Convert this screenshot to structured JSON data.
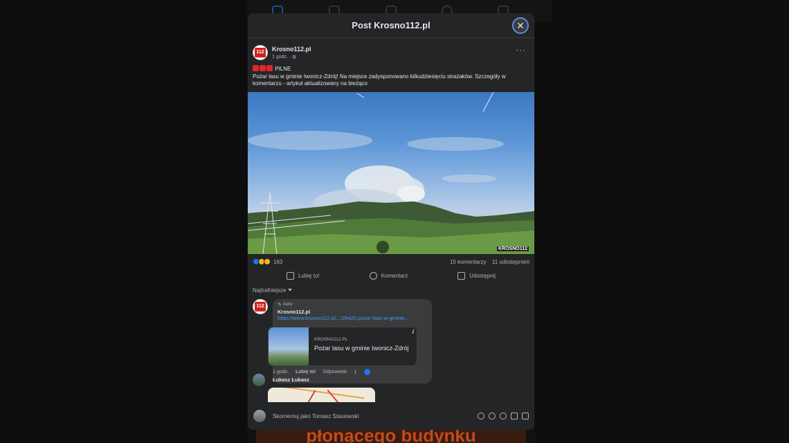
{
  "background": {
    "banner_text": "płonącego budynku"
  },
  "modal": {
    "title": "Post Krosno112.pl",
    "close_label": "✕"
  },
  "post": {
    "avatar_text": "112",
    "author": "Krosno112.pl",
    "time": "1 godz. · ",
    "globe_icon": "globe-icon",
    "more_label": "···",
    "tag": "PILNE",
    "text": "Pożar lasu w gminie Iwonicz-Zdrój! Na miejsce zadysponowano kilkudziesięciu strażaków. Szczegóły w komentarzu - artykuł aktualizowany na bieżąco",
    "photo_watermark": "KROSNO112"
  },
  "reactions": {
    "count": "163",
    "comments": "15 komentarzy",
    "shares": "11 udostępnień"
  },
  "actions": {
    "like": "Lubię to!",
    "comment": "Komentarz",
    "share": "Udostępnij"
  },
  "sort": {
    "label": "Najtrafniejsze"
  },
  "comment1": {
    "author_tag": "Autor",
    "name": "Krosno112.pl",
    "link": "https://www.krosno112.pl/.../29420,pozar-lasu-w-gminie...",
    "card_domain": "KROSNO112.PL",
    "card_title": "Pożar lasu w gminie Iwonicz-Zdrój",
    "card_info": "i",
    "time": "1 godz.",
    "like": "Lubię to!",
    "reply": "Odpowiedz",
    "likes": "1"
  },
  "comment2": {
    "name": "Łukasz Łukasz"
  },
  "composer": {
    "placeholder": "Skomentuj jako Tomasz Stasiowski"
  },
  "colors": {
    "modal_bg": "#242526",
    "accent": "#1877f2",
    "link": "#4599ff",
    "red": "#e2262a"
  }
}
